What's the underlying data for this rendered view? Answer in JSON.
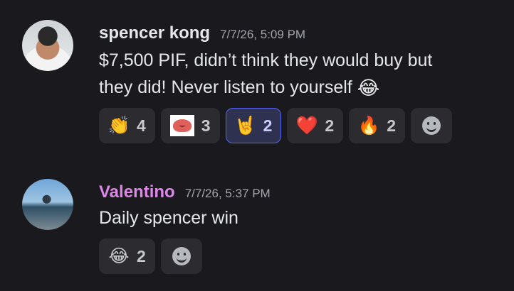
{
  "messages": [
    {
      "author": "spencer kong",
      "author_color": "#e6e7e9",
      "timestamp": "7/7/26, 5:09 PM",
      "line1": "$7,500 PIF, didn’t think they would buy but",
      "line2": "they did! Never listen to yourself",
      "inline_emoji": "😂",
      "reactions": [
        {
          "emoji": "👏",
          "icon": "clapping-hands-icon",
          "count": "4"
        },
        {
          "emoji": "",
          "icon": "blob-emoji-icon",
          "count": "3"
        },
        {
          "emoji": "🤘",
          "icon": "rock-on-hand-icon",
          "count": "2",
          "active": true
        },
        {
          "emoji": "❤️",
          "icon": "heart-icon",
          "count": "2"
        },
        {
          "emoji": "🔥",
          "icon": "fire-icon",
          "count": "2"
        }
      ]
    },
    {
      "author": "Valentino",
      "author_color": "#dd86e8",
      "timestamp": "7/7/26, 5:37 PM",
      "line1": "Daily spencer win",
      "reactions": [
        {
          "emoji": "😂",
          "icon": "tears-of-joy-icon",
          "count": "2"
        }
      ]
    }
  ]
}
